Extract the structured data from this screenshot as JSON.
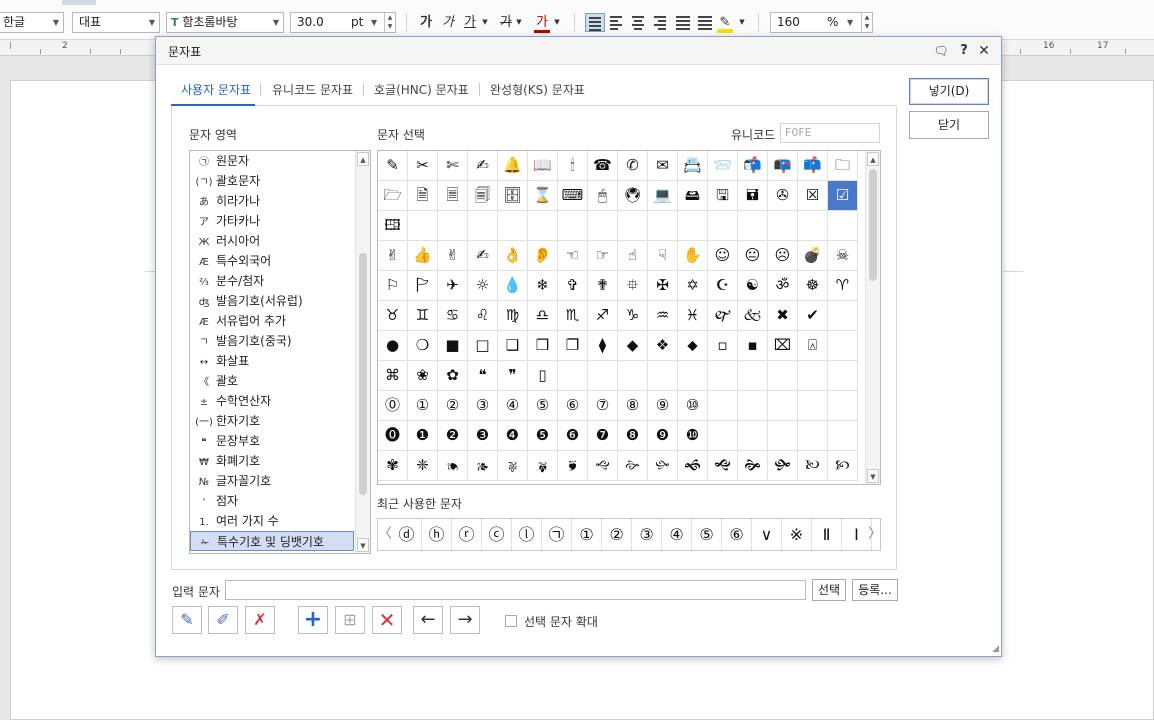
{
  "toolbar": {
    "lang_combo": "한글",
    "style_combo": "대표",
    "font_combo": "함초롬바탕",
    "size_value": "30.0",
    "size_unit": "pt",
    "bold": "가",
    "italic": "가",
    "underline": "가",
    "strike": "가",
    "font_color_char": "가",
    "line_spacing": "160",
    "line_spacing_unit": "%",
    "font_color_bar": "#c00000",
    "highlight_bar": "#f5e400"
  },
  "ruler": {
    "numbers": [
      "2",
      "16",
      "17"
    ]
  },
  "dialog": {
    "title": "문자표",
    "tabs": [
      "사용자 문자표",
      "유니코드 문자표",
      "호글(HNC) 문자표",
      "완성형(KS) 문자표"
    ],
    "area_label": "문자 영역",
    "select_label": "문자 선택",
    "unicode_label": "유니코드",
    "unicode_value": "F0FE",
    "insert_button": "넣기(D)",
    "close_button": "닫기",
    "areas": [
      {
        "icon": "㉠",
        "label": "원문자"
      },
      {
        "icon": "(ㄱ)",
        "label": "괄호문자"
      },
      {
        "icon": "あ",
        "label": "히라가나"
      },
      {
        "icon": "ア",
        "label": "가타카나"
      },
      {
        "icon": "Ж",
        "label": "러시아어"
      },
      {
        "icon": "Æ",
        "label": "특수외국어"
      },
      {
        "icon": "⅔",
        "label": "분수/첨자"
      },
      {
        "icon": "ʤ",
        "label": "발음기호(서유럽)"
      },
      {
        "icon": "Æ",
        "label": "서유럽어 추가"
      },
      {
        "icon": "ㄱ",
        "label": "발음기호(중국)"
      },
      {
        "icon": "↔",
        "label": "화살표"
      },
      {
        "icon": "《",
        "label": "괄호"
      },
      {
        "icon": "±",
        "label": "수학연산자"
      },
      {
        "icon": "(一)",
        "label": "한자기호"
      },
      {
        "icon": "❝",
        "label": "문장부호"
      },
      {
        "icon": "₩",
        "label": "화폐기호"
      },
      {
        "icon": "№",
        "label": "글자꼴기호"
      },
      {
        "icon": "'",
        "label": "점자"
      },
      {
        "icon": "1.",
        "label": "여러 가지 수"
      },
      {
        "icon": "✁",
        "label": "특수기호 및 딩뱃기호"
      }
    ],
    "glyphs": [
      [
        "✎",
        "✂",
        "✄",
        "✍",
        "🔔",
        "📖",
        "🕯",
        "☎",
        "✆",
        "✉",
        "📇",
        "📨",
        "📬",
        "📭",
        "📫",
        "🗀"
      ],
      [
        "🗁",
        "🗎",
        "🗏",
        "🗐",
        "🗄",
        "⌛",
        "⌨",
        "🖱",
        "🖲",
        "💻",
        "🖴",
        "🖫",
        "🖬",
        "✇",
        "☒",
        "☑"
      ],
      [
        "🖽",
        "",
        "",
        "",
        "",
        "",
        "",
        "",
        "",
        "",
        "",
        "",
        "",
        "",
        "",
        ""
      ],
      [
        "✌",
        "👍",
        "✌",
        "✍",
        "👌",
        "👂",
        "☜",
        "☞",
        "☝",
        "☟",
        "✋",
        "☺",
        "😐",
        "☹",
        "💣",
        "☠"
      ],
      [
        "⚐",
        "🏱",
        "✈",
        "☼",
        "💧",
        "❄",
        "✞",
        "✟",
        "⯐",
        "✠",
        "✡",
        "☪",
        "☯",
        "ॐ",
        "☸",
        "♈"
      ],
      [
        "♉",
        "♊",
        "♋",
        "♌",
        "♍",
        "♎",
        "♏",
        "♐",
        "♑",
        "♒",
        "♓",
        "🙰",
        "🙵",
        "✖",
        "✔",
        ""
      ],
      [
        "●",
        "❍",
        "■",
        "□",
        "❑",
        "❒",
        "❐",
        "⧫",
        "◆",
        "❖",
        "⬥",
        "▫",
        "▪",
        "⌧",
        "⍓",
        ""
      ],
      [
        "⌘",
        "❀",
        "✿",
        "❝",
        "❞",
        "▯",
        "",
        "",
        "",
        "",
        "",
        "",
        "",
        "",
        "",
        ""
      ],
      [
        "⓪",
        "①",
        "②",
        "③",
        "④",
        "⑤",
        "⑥",
        "⑦",
        "⑧",
        "⑨",
        "⑩",
        "",
        "",
        "",
        "",
        ""
      ],
      [
        "⓿",
        "❶",
        "❷",
        "❸",
        "❹",
        "❺",
        "❻",
        "❼",
        "❽",
        "❾",
        "❿",
        "",
        "",
        "",
        "",
        ""
      ],
      [
        "✾",
        "❈",
        "🙔",
        "🙕",
        "🙖",
        "🙗",
        "🙘",
        "🙙",
        "🙚",
        "🙛",
        "🙜",
        "🙝",
        "🙞",
        "🙟",
        "🙠",
        "🙡"
      ]
    ],
    "recent_label": "최근 사용한 문자",
    "recent": [
      "ⓓ",
      "ⓗ",
      "ⓡ",
      "ⓒ",
      "ⓛ",
      "㉠",
      "①",
      "②",
      "③",
      "④",
      "⑤",
      "⑥",
      "∨",
      "※",
      "Ⅱ",
      "Ⅰ"
    ],
    "input_label": "입력 문자",
    "input_value": "",
    "select_button": "선택",
    "register_button": "등록...",
    "expand_label": "선택 문자 확대",
    "accent": "#2b62c6"
  }
}
